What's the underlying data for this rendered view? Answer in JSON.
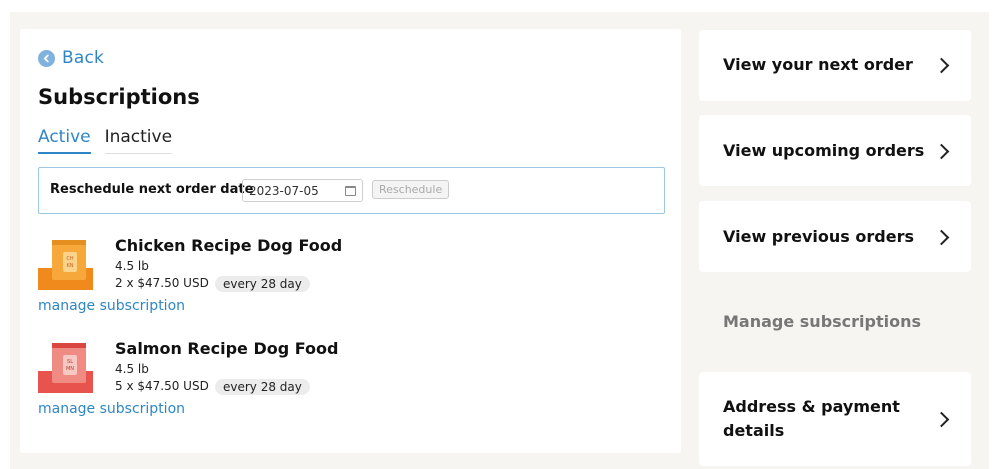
{
  "back": {
    "label": "Back",
    "icon": "chevron-left-circle-icon"
  },
  "page": {
    "title": "Subscriptions"
  },
  "tabs": [
    {
      "label": "Active",
      "active": true
    },
    {
      "label": "Inactive",
      "active": false
    }
  ],
  "reschedule": {
    "label": "Reschedule next order date",
    "date_value": "2023-07-05",
    "button_label": "Reschedule"
  },
  "subscriptions": [
    {
      "name": "Chicken Recipe Dog Food",
      "size": "4.5 lb",
      "qty_price": "2 x $47.50 USD",
      "frequency": "every 28 day",
      "manage_label": "manage subscription",
      "package_color": "#f08a1c"
    },
    {
      "name": "Salmon Recipe Dog Food",
      "size": "4.5 lb",
      "qty_price": "5 x $47.50 USD",
      "frequency": "every 28 day",
      "manage_label": "manage subscription",
      "package_color": "#e8544d"
    }
  ],
  "sidebar": {
    "items": [
      {
        "label": "View your next order",
        "enabled": true
      },
      {
        "label": "View upcoming orders",
        "enabled": true
      },
      {
        "label": "View previous orders",
        "enabled": true
      },
      {
        "label": "Manage subscriptions",
        "enabled": false
      },
      {
        "label": "Address & payment details",
        "enabled": true
      }
    ]
  },
  "colors": {
    "accent": "#2f86c4",
    "background": "#f6f5f1"
  }
}
